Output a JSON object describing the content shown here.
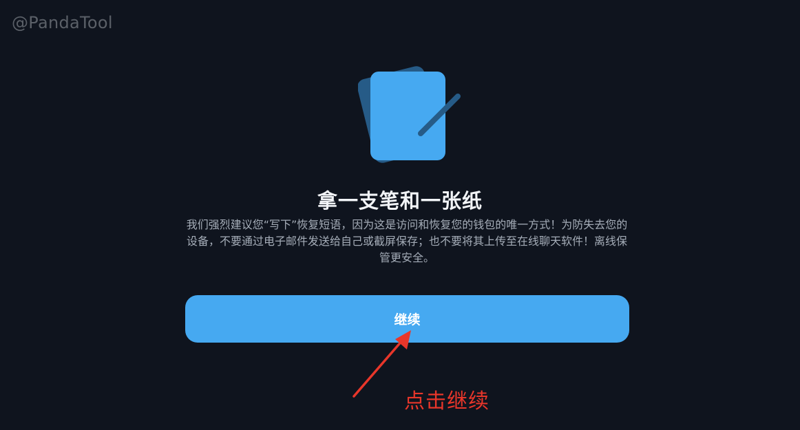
{
  "watermark": "@PandaTool",
  "icon": {
    "name": "notepad-pen-icon",
    "colors": {
      "back": "#265b87",
      "front": "#46a9f1",
      "pen": "#265b87"
    }
  },
  "title": "拿一支笔和一张纸",
  "description": "我们强烈建议您“写下”恢复短语，因为这是访问和恢复您的钱包的唯一方式！为防失去您的设备，不要通过电子邮件发送给自己或截屏保存；也不要将其上传至在线聊天软件！离线保管更安全。",
  "continue_button": {
    "label": "继续",
    "color": "#46a9f1"
  },
  "annotation": {
    "text": "点击继续",
    "color": "#e8362a"
  }
}
